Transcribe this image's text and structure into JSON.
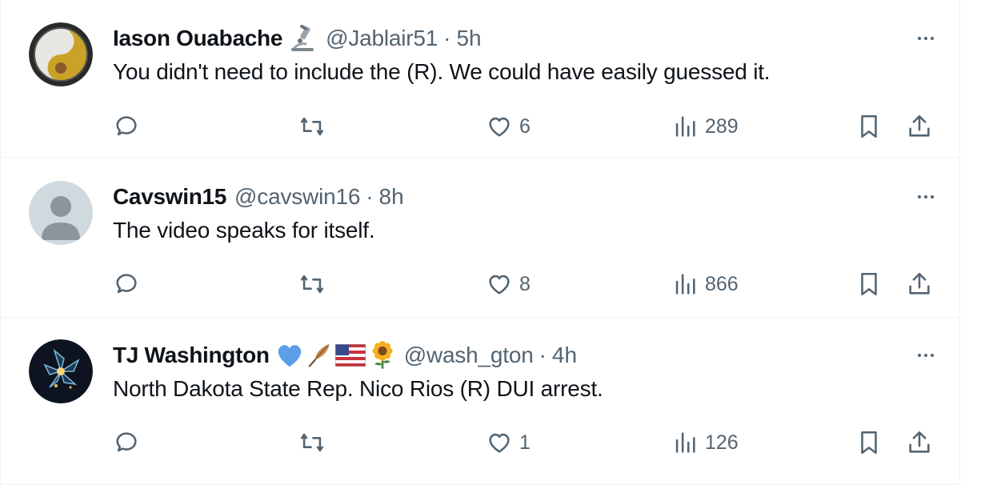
{
  "tweets": [
    {
      "name": "Iason Ouabache",
      "badges": [
        "microscope-emoji"
      ],
      "handle": "@Jablair51",
      "separator": "·",
      "time": "5h",
      "text": "You didn't need to include the (R). We could have easily guessed it.",
      "likes": "6",
      "views": "289"
    },
    {
      "name": "Cavswin15",
      "badges": [],
      "handle": "@cavswin16",
      "separator": "·",
      "time": "8h",
      "text": "The video speaks for itself.",
      "likes": "8",
      "views": "866"
    },
    {
      "name": "TJ Washington",
      "badges": [
        "blue-heart-emoji",
        "feather-emoji",
        "us-flag-emoji",
        "sunflower-emoji"
      ],
      "handle": "@wash_gton",
      "separator": "·",
      "time": "4h",
      "text": "North Dakota State Rep. Nico Rios (R) DUI arrest.",
      "likes": "1",
      "views": "126"
    }
  ],
  "colors": {
    "text": "#0f1419",
    "secondary": "#536471",
    "border": "#eff3f4",
    "heart": "#5d9ee8"
  }
}
